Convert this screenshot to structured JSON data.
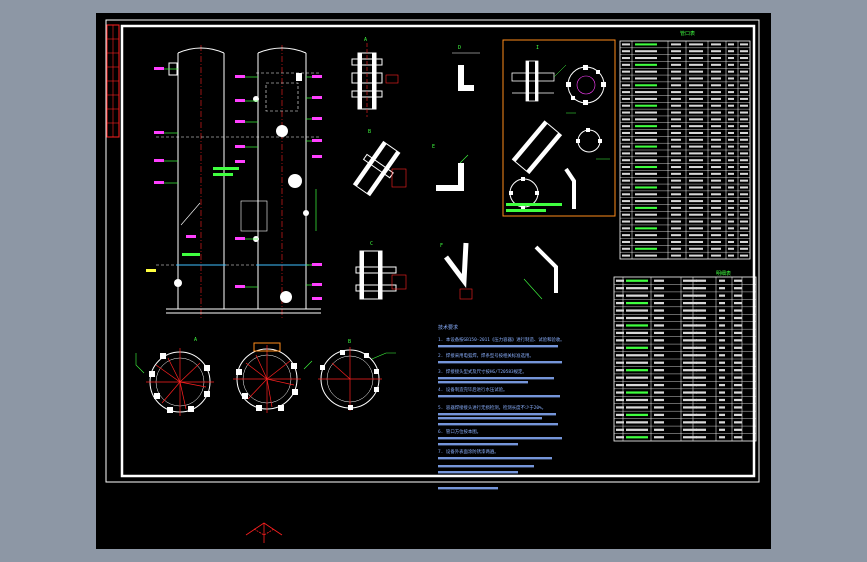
{
  "drawing": {
    "detail_a_label": "A",
    "detail_b_label": "B",
    "detail_c_label": "C",
    "detail_d_label": "D",
    "detail_e_label": "E",
    "detail_f_label": "F",
    "enlarged_label": "I",
    "table_title": "管口表",
    "parts_title": "明细表",
    "notes_title": "技术要求",
    "notes": [
      "1. 本设备按GB150-2011《压力容器》进行制造、试验和验收。",
      "2. 焊接采用电弧焊，焊条型号按相关标准选用。",
      "3. 焊接接头型式及尺寸按HG/T20583规定。",
      "4. 设备制造完毕后进行水压试验。",
      "5. 容器焊接接头进行无损检测，检测长度不少于20%。",
      "6. 管口方位按本图。",
      "7. 设备外表面涂防锈漆两遍。"
    ],
    "colors": {
      "frame": "#ffffff",
      "line": "#ffffff",
      "dim": "#00ff00",
      "text": "#8ab0ff",
      "accent": "#ff40ff",
      "center": "#ff2020",
      "highlight": "#ff8c1a"
    }
  },
  "nozzle_table_rows": 32,
  "parts_table_rows": 22
}
